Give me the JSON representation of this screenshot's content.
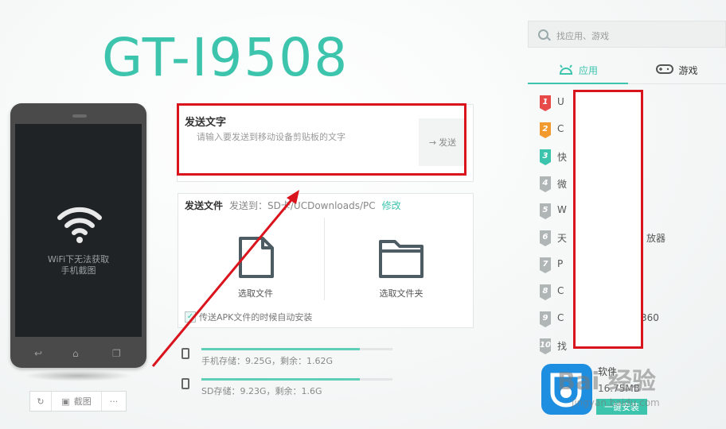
{
  "device": {
    "title": "GT-I9508"
  },
  "phone": {
    "screen_msg_line1": "WiFi下无法获取",
    "screen_msg_line2": "手机截图"
  },
  "phone_toolbar": {
    "refresh_icon": "refresh-icon",
    "camera_icon": "camera-icon",
    "screenshot_label": "截图",
    "more_label": "···"
  },
  "send_text": {
    "title": "发送文字",
    "placeholder": "请输入要发送到移动设备剪贴板的文字",
    "send_label": "发送"
  },
  "send_file": {
    "title": "发送文件",
    "dest_label": "发送到：",
    "dest_path": "SD卡/UCDownloads/PC",
    "edit_label": "修改",
    "choose_file_label": "选取文件",
    "choose_folder_label": "选取文件夹",
    "auto_install_label": "传送APK文件的时候自动安装",
    "auto_install_checked": true
  },
  "storage": [
    {
      "label": "手机存储：9.25G，剩余：1.62G",
      "used_fraction": 0.83
    },
    {
      "label": "SD存储：9.23G，剩余：1.6G",
      "used_fraction": 0.83
    }
  ],
  "right_panel": {
    "search_placeholder": "找应用、游戏",
    "tabs": [
      {
        "label": "应用",
        "active": true
      },
      {
        "label": "游戏",
        "active": false
      }
    ],
    "ranking": [
      {
        "rank": "1",
        "name": "U",
        "extra": "",
        "color": "#e84a4a"
      },
      {
        "rank": "2",
        "name": "C",
        "extra": "",
        "color": "#f29a2e"
      },
      {
        "rank": "3",
        "name": "快",
        "extra": "",
        "color": "#3cc4ad"
      },
      {
        "rank": "4",
        "name": "微",
        "extra": "",
        "color": "#b0b6b6"
      },
      {
        "rank": "5",
        "name": "W",
        "extra": "",
        "color": "#b0b6b6"
      },
      {
        "rank": "6",
        "name": "天",
        "extra": "放器",
        "color": "#b0b6b6"
      },
      {
        "rank": "7",
        "name": "P",
        "extra": "",
        "color": "#b0b6b6"
      },
      {
        "rank": "8",
        "name": "C",
        "extra": "",
        "color": "#b0b6b6"
      },
      {
        "rank": "9",
        "name": "C",
        "extra": "360",
        "color": "#b0b6b6"
      },
      {
        "rank": "10",
        "name": "找",
        "extra": "",
        "color": "#b0b6b6"
      }
    ],
    "featured_app": {
      "name": "软件",
      "size": "16.75MB",
      "button": "一键安装"
    }
  },
  "watermark": {
    "text": "Bai 经验",
    "sub": "jingyan.baidu.com"
  },
  "colors": {
    "accent": "#3cc4ad",
    "highlight_red": "#d9141d"
  }
}
